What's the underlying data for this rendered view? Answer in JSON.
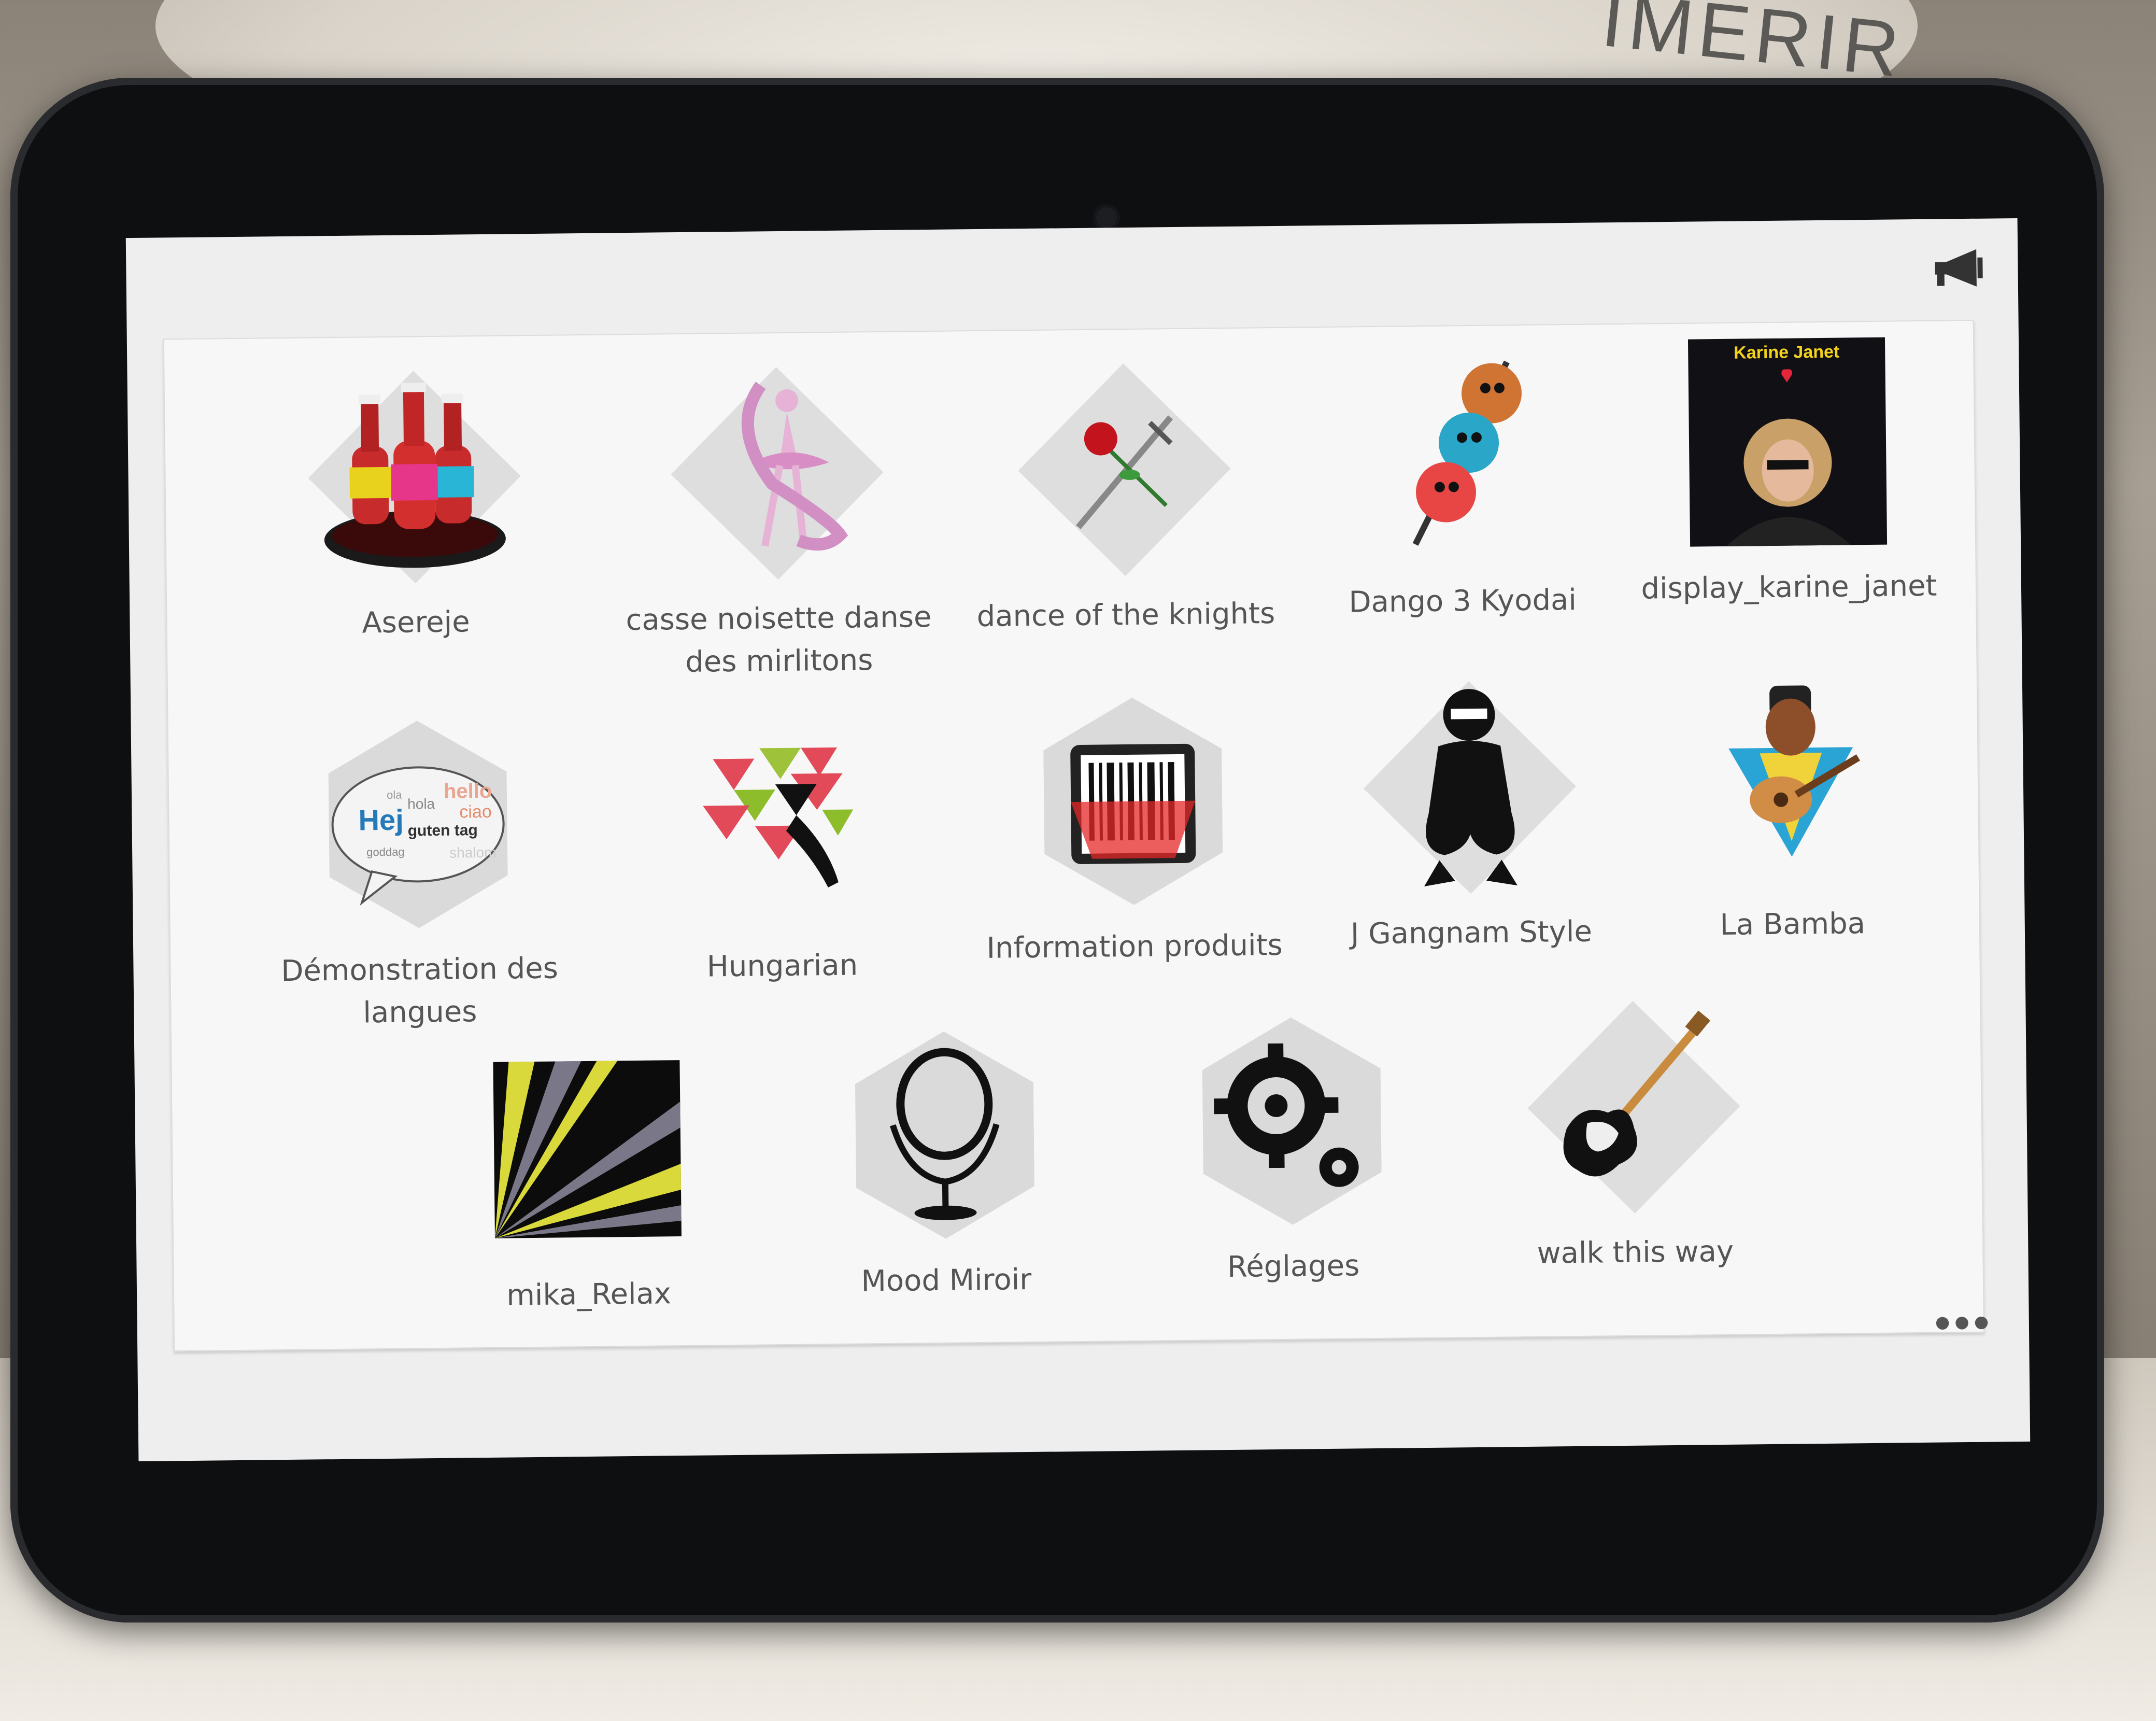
{
  "robot": {
    "label": "IMERIR"
  },
  "screen": {
    "more_menu": "•••",
    "apps": [
      {
        "label": "Asereje",
        "icon": "ketchup-bottles-icon"
      },
      {
        "label": "casse noisette danse des mirlitons",
        "icon": "ballerina-icon"
      },
      {
        "label": "dance of the knights",
        "icon": "rose-sword-icon"
      },
      {
        "label": "Dango 3 Kyodai",
        "icon": "dango-skewer-icon"
      },
      {
        "label": "display_karine_janet",
        "icon": "karine-janet-poster-icon",
        "poster_title": "Karine Janet"
      },
      {
        "label": "Démonstration des langues",
        "icon": "speech-bubble-languages-icon",
        "bubble_words": [
          "Hej",
          "guten tag",
          "ciao",
          "hello",
          "hola",
          "ola",
          "goddag",
          "shalom"
        ]
      },
      {
        "label": "Hungarian",
        "icon": "triangles-dancer-icon"
      },
      {
        "label": "Information produits",
        "icon": "barcode-scanner-icon"
      },
      {
        "label": "J Gangnam Style",
        "icon": "gangnam-dancer-icon"
      },
      {
        "label": "La Bamba",
        "icon": "guitar-player-icon"
      },
      {
        "label": "mika_Relax",
        "icon": "light-rays-icon"
      },
      {
        "label": "Mood Miroir",
        "icon": "mirror-icon"
      },
      {
        "label": "Réglages",
        "icon": "gears-icon"
      },
      {
        "label": "walk this way",
        "icon": "electric-guitar-icon"
      }
    ]
  }
}
